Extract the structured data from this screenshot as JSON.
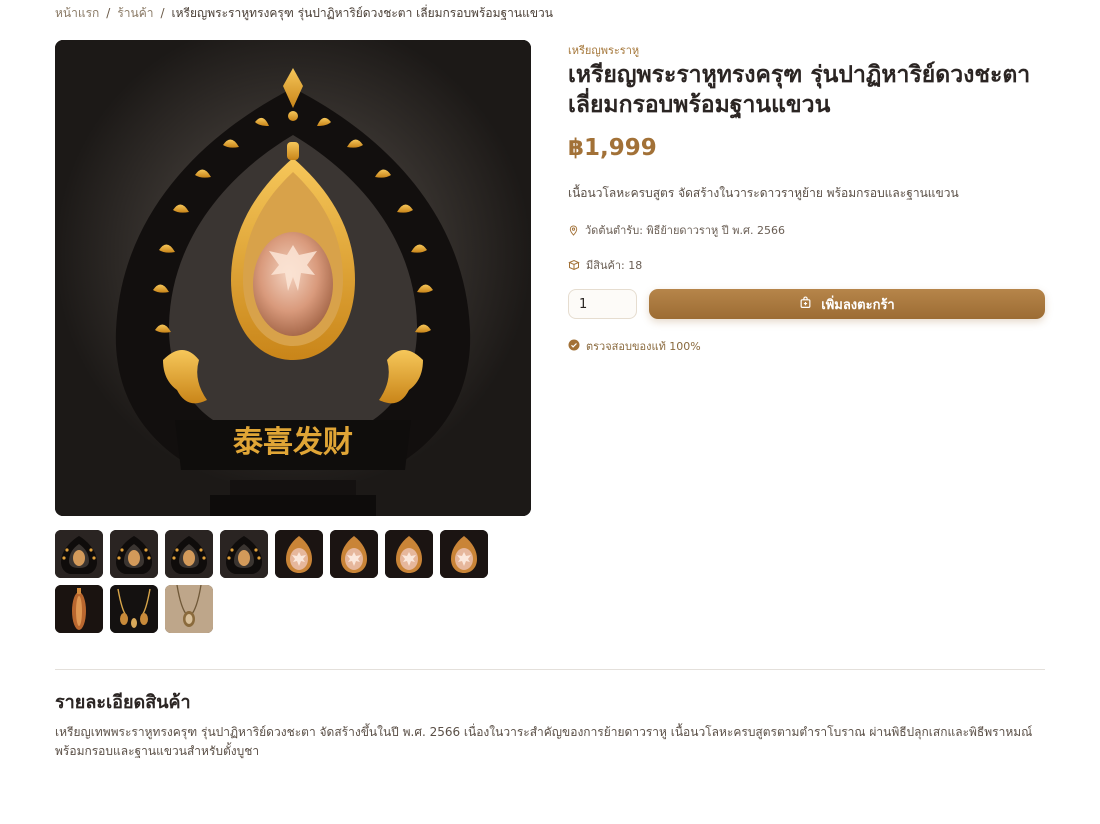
{
  "breadcrumb": {
    "home": "หน้าแรก",
    "shop": "ร้านค้า",
    "current": "เหรียญพระราหูทรงครุฑ รุ่นปาฏิหาริย์ดวงชะตา เลี่ยมกรอบพร้อมฐานแขวน"
  },
  "product": {
    "category": "เหรียญพระราหู",
    "title": "เหรียญพระราหูทรงครุฑ รุ่นปาฏิหาริย์ดวงชะตา เลี่ยมกรอบพร้อมฐานแขวน",
    "price": "฿1,999",
    "short_description": "เนื้อนวโลหะครบสูตร จัดสร้างในวาระดาวราหูย้าย พร้อมกรอบและฐานแขวน",
    "origin": "วัดต้นตำรับ: พิธีย้ายดาวราหู ปี พ.ศ. 2566",
    "stock": "มีสินค้า: 18",
    "quantity": "1",
    "add_to_cart_label": "เพิ่มลงตะกร้า",
    "authentic_label": "ตรวจสอบของแท้ 100%"
  },
  "details": {
    "heading": "รายละเอียดสินค้า",
    "body": "เหรียญเทพพระราหูทรงครุฑ รุ่นปาฏิหาริย์ดวงชะตา จัดสร้างขึ้นในปี พ.ศ. 2566 เนื่องในวาระสำคัญของการย้ายดาวราหู เนื้อนวโลหะครบสูตรตามตำราโบราณ ผ่านพิธีปลุกเสกและพิธีพราหมณ์ พร้อมกรอบและฐานแขวนสำหรับตั้งบูชา"
  },
  "image_text": {
    "base_characters": "泰喜发财"
  },
  "thumbnails": [
    {
      "variant": "dark-frame"
    },
    {
      "variant": "dark-frame"
    },
    {
      "variant": "dark-frame"
    },
    {
      "variant": "dark-frame"
    },
    {
      "variant": "medallion"
    },
    {
      "variant": "medallion"
    },
    {
      "variant": "medallion"
    },
    {
      "variant": "medallion"
    },
    {
      "variant": "side-view"
    },
    {
      "variant": "necklace"
    },
    {
      "variant": "worn"
    }
  ],
  "colors": {
    "accent": "#a27137",
    "button": "#b07c41",
    "text_dark": "#2b2523",
    "muted": "#8a7a66"
  }
}
